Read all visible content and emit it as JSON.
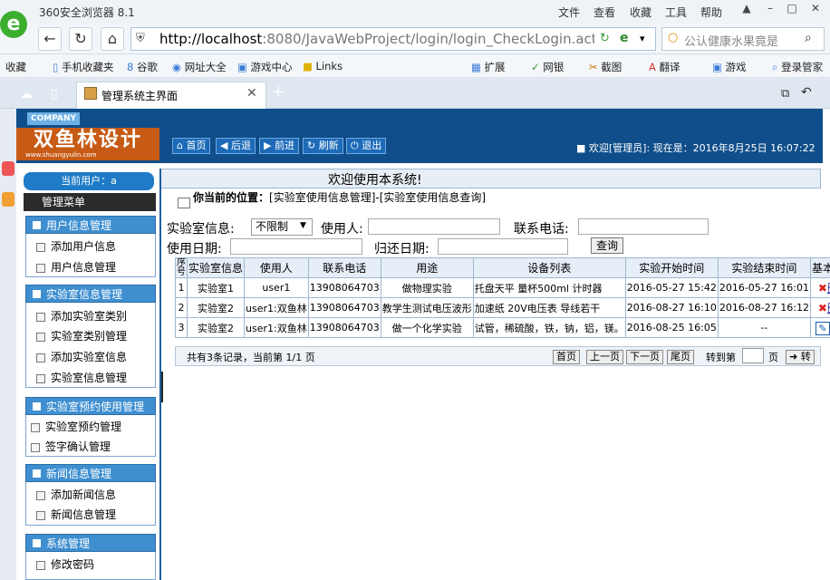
{
  "browser": {
    "app_name": "360安全浏览器 8.1",
    "menus": [
      "文件",
      "查看",
      "收藏",
      "工具",
      "帮助"
    ],
    "url_host": "http://localhost",
    "url_rest": ":8080/JavaWebProject/login/login_CheckLogin.action",
    "search_text": "公认健康水果竟是",
    "bookmarks": [
      "收藏",
      "手机收藏夹",
      "谷歌",
      "网址大全",
      "游戏中心",
      "Links"
    ],
    "tools": [
      "扩展",
      "网银",
      "截图",
      "翻译",
      "游戏",
      "登录管家"
    ],
    "tab_title": "管理系统主界面"
  },
  "header": {
    "company": "COMPANY",
    "logo_text": "双鱼林设计",
    "logo_url": "www.shuangyulin.com",
    "buttons": [
      "首页",
      "后退",
      "前进",
      "刷新",
      "退出"
    ],
    "welcome": "欢迎[管理员]:  现在是：2016年8月25日 16:07:22"
  },
  "title": "欢迎使用本系统!",
  "sidebar": {
    "current_user": "当前用户：a",
    "menu_title": "管理菜单",
    "sections": [
      {
        "title": "用户信息管理",
        "items": [
          "添加用户信息",
          "用户信息管理"
        ]
      },
      {
        "title": "实验室信息管理",
        "items": [
          "添加实验室类别",
          "实验室类别管理",
          "添加实验室信息",
          "实验室信息管理"
        ]
      },
      {
        "title": "实验室预约使用管理",
        "items": [
          "实验室预约管理",
          "签字确认管理"
        ]
      },
      {
        "title": "新闻信息管理",
        "items": [
          "添加新闻信息",
          "新闻信息管理"
        ]
      },
      {
        "title": "系统管理",
        "items": [
          "修改密码"
        ]
      }
    ]
  },
  "content": {
    "position_label": "你当前的位置：",
    "position_path": "[实验室使用信息管理]-[实验室使用信息查询]",
    "filters": {
      "lab_label": "实验室信息:",
      "lab_value": "不限制",
      "user_label": "使用人:",
      "phone_label": "联系电话:",
      "use_date_label": "使用日期:",
      "return_date_label": "归还日期:",
      "query_button": "查询"
    },
    "table": {
      "headers": [
        "序号",
        "实验室信息",
        "使用人",
        "联系电话",
        "用途",
        "设备列表",
        "实验开始时间",
        "实验结束时间",
        "基本操作"
      ],
      "rows": [
        [
          "1",
          "实验室1",
          "user1",
          "13908064703",
          "做物理实验",
          "托盘天平 量杯500ml 计时器",
          "2016-05-27 15:42",
          "2016-05-27 16:01",
          "删除"
        ],
        [
          "2",
          "实验室2",
          "user1:双鱼林",
          "13908064703",
          "教学生测试电压波形",
          "加速纸 20V电压表 导线若干",
          "2016-08-27 16:10",
          "2016-08-27 16:12",
          "删除"
        ],
        [
          "3",
          "实验室2",
          "user1:双鱼林",
          "13908064703",
          "做一个化学实验",
          "试管，稀硫酸，铁，钠，铝，镁。",
          "2016-08-25 16:05",
          "--",
          "归还"
        ]
      ]
    },
    "pager": {
      "summary": "共有3条记录，当前第 1/1 页",
      "buttons": [
        "首页",
        "上一页",
        "下一页",
        "尾页"
      ],
      "goto_label": "转到第",
      "page_label": "页",
      "go_button": "转"
    }
  },
  "colors": {
    "header_bg": "#0f4e8a",
    "section_bg": "#3f8fd0",
    "logo_bg": "#c75b15"
  }
}
